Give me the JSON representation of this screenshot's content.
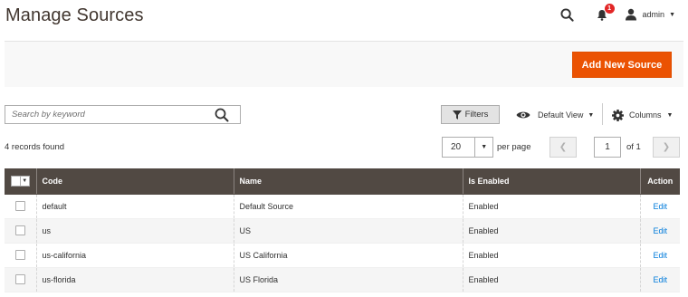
{
  "header": {
    "title": "Manage Sources",
    "notification_count": "1",
    "user_name": "admin"
  },
  "actions": {
    "add_button": "Add New Source"
  },
  "toolbar": {
    "search_placeholder": "Search by keyword",
    "filters_label": "Filters",
    "view_label": "Default View",
    "columns_label": "Columns",
    "records_found": "4 records found",
    "per_page_value": "20",
    "per_page_label": "per page",
    "current_page": "1",
    "total_pages_label": "of 1"
  },
  "grid": {
    "columns": [
      "Code",
      "Name",
      "Is Enabled",
      "Action"
    ],
    "rows": [
      {
        "code": "default",
        "name": "Default Source",
        "enabled": "Enabled",
        "action": "Edit"
      },
      {
        "code": "us",
        "name": "US",
        "enabled": "Enabled",
        "action": "Edit"
      },
      {
        "code": "us-california",
        "name": "US California",
        "enabled": "Enabled",
        "action": "Edit"
      },
      {
        "code": "us-florida",
        "name": "US Florida",
        "enabled": "Enabled",
        "action": "Edit"
      }
    ]
  },
  "icons": {
    "search": "search-icon",
    "notifications": "bell-icon",
    "user": "user-icon",
    "filter": "funnel-icon",
    "view": "eye-icon",
    "columns": "gear-icon"
  },
  "colors": {
    "accent": "#eb5202",
    "grid_header": "#514943",
    "link": "#007bdb",
    "badge": "#e22626"
  }
}
